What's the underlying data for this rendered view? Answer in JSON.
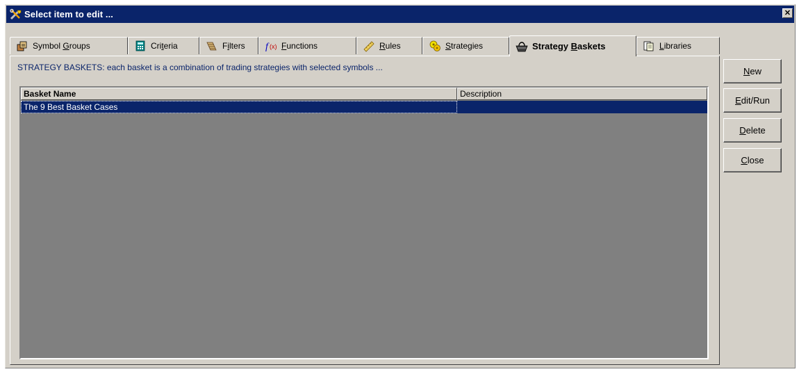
{
  "window": {
    "title": "Select item to edit ...",
    "close_glyph": "✕"
  },
  "tabs": [
    {
      "icon": "symbol-groups-icon",
      "pre": "Symbol ",
      "key": "G",
      "post": "roups"
    },
    {
      "icon": "calculator-icon",
      "pre": "Cri",
      "key": "t",
      "post": "eria"
    },
    {
      "icon": "filter-icon",
      "pre": "F",
      "key": "i",
      "post": "lters"
    },
    {
      "icon": "function-icon",
      "pre": "",
      "key": "F",
      "post": "unctions"
    },
    {
      "icon": "ruler-icon",
      "pre": "",
      "key": "R",
      "post": "ules"
    },
    {
      "icon": "strategy-icon",
      "pre": "",
      "key": "S",
      "post": "trategies"
    },
    {
      "icon": "basket-icon",
      "pre": "Strategy ",
      "key": "B",
      "post": "askets"
    },
    {
      "icon": "library-icon",
      "pre": "",
      "key": "L",
      "post": "ibraries"
    }
  ],
  "panel": {
    "description": "STRATEGY BASKETS: each basket is a combination of trading strategies with selected symbols ..."
  },
  "table": {
    "columns": [
      "Basket Name",
      "Description"
    ],
    "rows": [
      {
        "name": "The 9 Best Basket Cases",
        "description": ""
      }
    ]
  },
  "buttons": [
    {
      "key": "N",
      "post": "ew"
    },
    {
      "key": "E",
      "post": "dit/Run"
    },
    {
      "key": "D",
      "post": "elete"
    },
    {
      "key": "C",
      "post": "lose"
    }
  ],
  "colors": {
    "titlebar": "#0a246a",
    "face": "#d4d0c8",
    "selection": "#0a246a",
    "list_bg": "#808080"
  }
}
